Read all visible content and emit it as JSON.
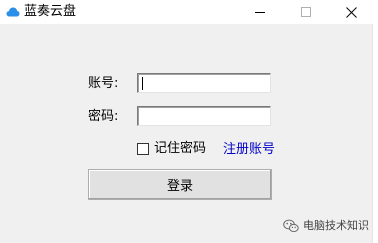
{
  "window": {
    "title": "蓝奏云盘",
    "icon": "cloud-icon",
    "controls": [
      "minimize-icon",
      "maximize-icon",
      "close-icon"
    ]
  },
  "form": {
    "account_label": "账号:",
    "password_label": "密码:",
    "account_value": "",
    "password_value": "",
    "remember_label": "记住密码",
    "remember_checked": false,
    "register_link": "注册账号",
    "login_button": "登录"
  },
  "watermark": {
    "text": "电脑技术知识",
    "icon": "wechat-icon"
  },
  "colors": {
    "link": "#0000c8",
    "cloud_icon": "#2a8fe8"
  }
}
